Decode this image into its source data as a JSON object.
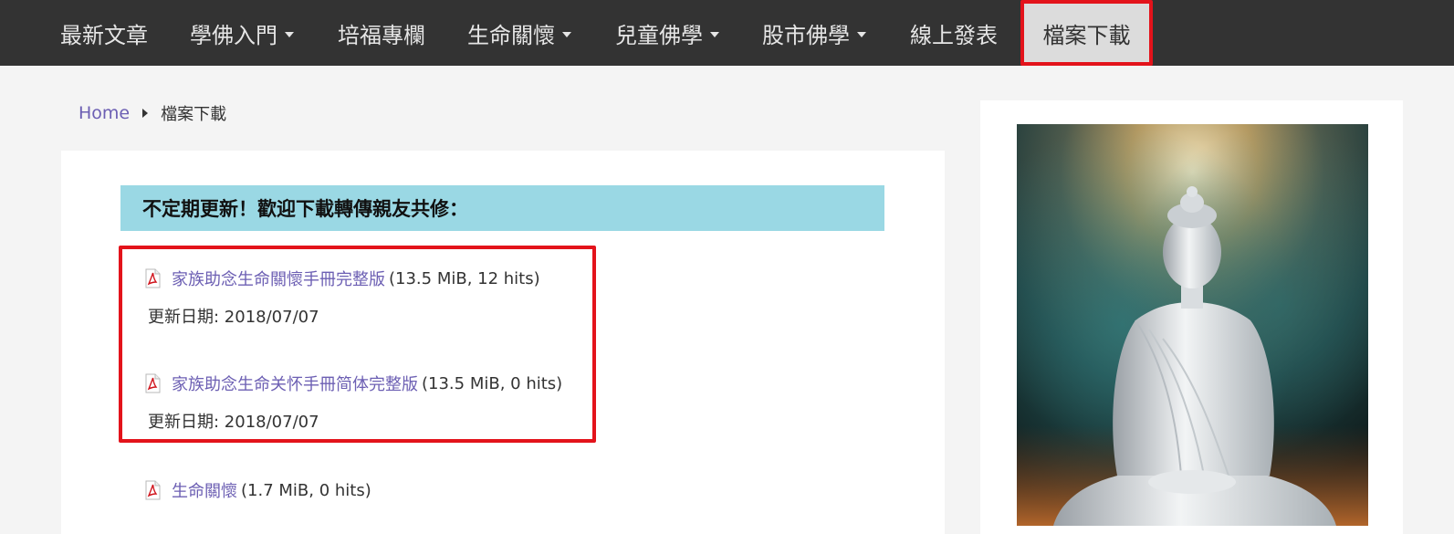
{
  "nav": {
    "items": [
      {
        "label": "最新文章",
        "dropdown": false
      },
      {
        "label": "學佛入門",
        "dropdown": true
      },
      {
        "label": "培福專欄",
        "dropdown": false
      },
      {
        "label": "生命關懷",
        "dropdown": true
      },
      {
        "label": "兒童佛學",
        "dropdown": true
      },
      {
        "label": "股市佛學",
        "dropdown": true
      },
      {
        "label": "線上發表",
        "dropdown": false
      },
      {
        "label": "檔案下載",
        "dropdown": false,
        "active": true
      }
    ]
  },
  "breadcrumb": {
    "home": "Home",
    "current": "檔案下載"
  },
  "category": {
    "title": "不定期更新！歡迎下載轉傳親友共修："
  },
  "files": [
    {
      "name": "家族助念生命關懷手冊完整版",
      "meta": "(13.5 MiB, 12 hits)",
      "update": "更新日期: 2018/07/07"
    },
    {
      "name": "家族助念生命关怀手冊简体完整版",
      "meta": "(13.5 MiB, 0 hits)",
      "update": "更新日期: 2018/07/07"
    },
    {
      "name": "生命關懷",
      "meta": "(1.7 MiB, 0 hits)"
    }
  ],
  "colors": {
    "navbar_bg": "#333333",
    "link": "#6c5fb3",
    "header_bg": "#9ad8e4",
    "highlight": "#e3131b"
  },
  "icons": {
    "file": "pdf-icon",
    "breadcrumb_separator": "caret-right-icon",
    "dropdown": "caret-down-icon"
  }
}
